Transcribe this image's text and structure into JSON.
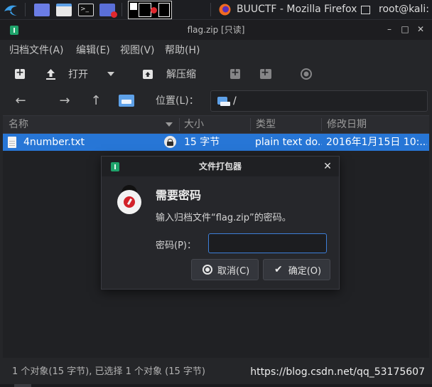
{
  "taskbar": {
    "active_window": "BUUCTF - Mozilla Firefox",
    "terminal_window": "root@kali: ~"
  },
  "window": {
    "title": "flag.zip [只读]",
    "minimize": "–",
    "maximize": "□",
    "close": "✕"
  },
  "menubar": {
    "items": [
      "归档文件(A)",
      "编辑(E)",
      "视图(V)",
      "帮助(H)"
    ]
  },
  "toolbar": {
    "open_label": "打开",
    "extract_label": "解压缩"
  },
  "location": {
    "label": "位置(L)：",
    "path": "/"
  },
  "columns": {
    "name": "名称",
    "size": "大小",
    "type": "类型",
    "modified": "修改日期"
  },
  "files": [
    {
      "name": "4number.txt",
      "size": "15 字节",
      "type": "plain text do...",
      "modified": "2016年1月15日 10:..."
    }
  ],
  "status": {
    "text": "1 个对象(15 字节), 已选择 1 个对象 (15 字节)",
    "watermark": "https://blog.csdn.net/qq_53175607"
  },
  "dialog": {
    "title": "文件打包器",
    "close": "✕",
    "heading": "需要密码",
    "message": "输入归档文件“flag.zip”的密码。",
    "password_label": "密码(P)：",
    "password_value": "",
    "cancel_label": "取消(C)",
    "ok_label": "确定(O)"
  },
  "colors": {
    "selection": "#2776d6",
    "accent": "#3d7fd9",
    "warning_icon": "#d3232a",
    "archive_icon": "#1fa36b"
  },
  "icons": [
    "kali-dragon-icon",
    "firefox-icon",
    "terminal-icon",
    "new-archive-icon",
    "open-icon",
    "extract-icon",
    "add-file-icon",
    "add-folder-icon",
    "stop-icon",
    "back-arrow-icon",
    "forward-arrow-icon",
    "up-arrow-icon",
    "home-folder-icon",
    "lock-icon",
    "text-file-icon",
    "warning-icon",
    "cancel-icon",
    "check-icon"
  ]
}
